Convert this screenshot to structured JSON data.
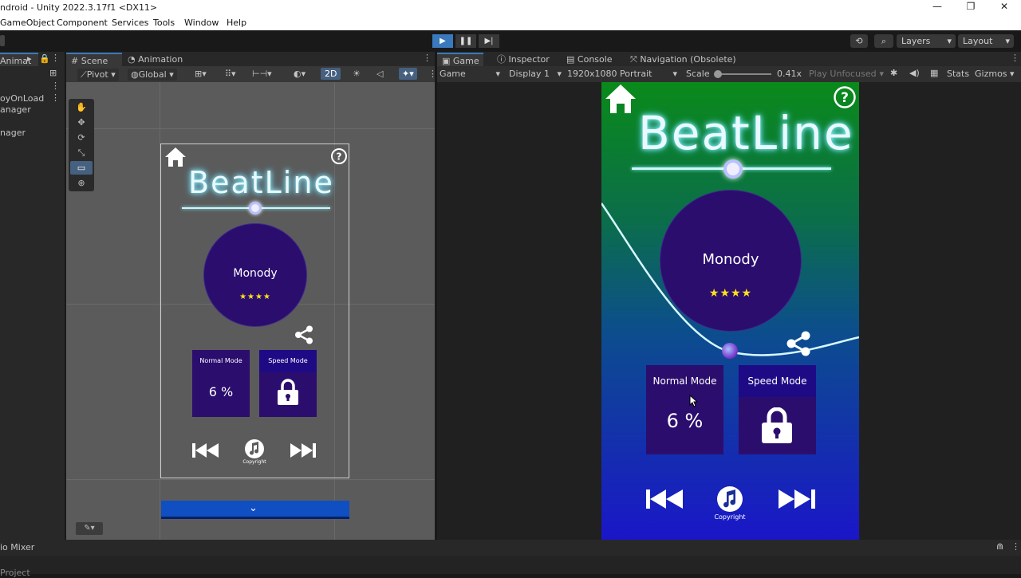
{
  "window": {
    "title": "ndroid - Unity 2022.3.17f1 <DX11>"
  },
  "menu": [
    "GameObject",
    "Component",
    "Services",
    "Tools",
    "Window",
    "Help"
  ],
  "toolbar": {
    "layers_label": "Layers",
    "layout_label": "Layout"
  },
  "hierarchy": {
    "tab_label": "Animat",
    "items": [
      "oyOnLoad",
      "anager",
      "nager"
    ]
  },
  "scene": {
    "tabs": [
      "Scene",
      "Animation"
    ],
    "pivot_label": "Pivot",
    "global_label": "Global",
    "mode_2d_label": "2D"
  },
  "game": {
    "tabs": [
      "Game",
      "Inspector",
      "Console",
      "Navigation (Obsolete)"
    ],
    "view_select": "Game",
    "display_select": "Display 1",
    "resolution_select": "1920x1080 Portrait",
    "scale_label": "Scale",
    "scale_value": "0.41x",
    "play_mode_select": "Play Unfocused",
    "stats_label": "Stats",
    "gizmos_label": "Gizmos"
  },
  "app": {
    "title": "BeatLine",
    "song_name": "Monody",
    "stars": "★★★★",
    "normal_mode_label": "Normal Mode",
    "speed_mode_label": "Speed Mode",
    "normal_mode_progress": "6 %",
    "copyright_label": "Copyright"
  },
  "bottom": {
    "audio_mixer_label": "io Mixer",
    "project_label": "Project"
  },
  "colors": {
    "accent_play": "#3a79bb",
    "card_purple": "#2b0d6e",
    "star_yellow": "#ffe11a",
    "game_bg_top": "#0a8a1a",
    "game_bg_bottom": "#1a16c8"
  }
}
